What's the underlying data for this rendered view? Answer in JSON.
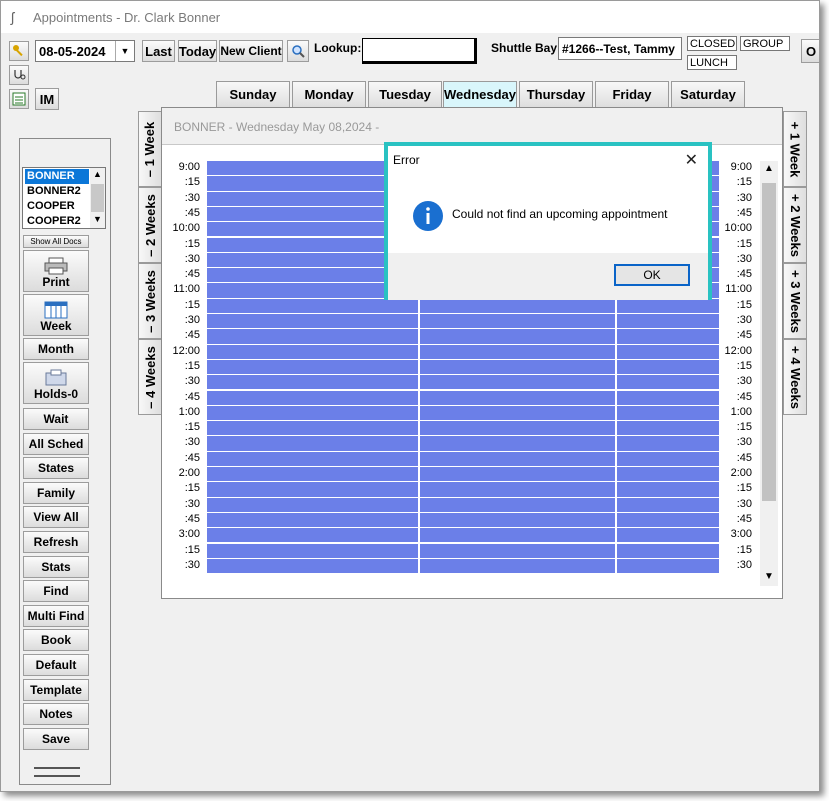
{
  "window": {
    "title": "Appointments - Dr. Clark Bonner"
  },
  "toolbar": {
    "date_value": "08-05-2024",
    "last_label": "Last",
    "today_label": "Today",
    "new_client_label": "New Client",
    "lookup_label": "Lookup:",
    "lookup_value": "",
    "shuttle_label": "Shuttle Bay",
    "shuttle_value": "#1266--Test, Tammy",
    "closed_label": "CLOSED",
    "group_label": "GROUP",
    "lunch_label": "LUNCH",
    "im_label": "IM",
    "cut_label": "O"
  },
  "day_tabs": [
    "Sunday",
    "Monday",
    "Tuesday",
    "Wednesday",
    "Thursday",
    "Friday",
    "Saturday"
  ],
  "active_day": "Wednesday",
  "left_week_tabs": [
    "– 1 Week",
    "– 2 Weeks",
    "– 3 Weeks",
    "– 4 Weeks"
  ],
  "right_week_tabs": [
    "+ 1 Week",
    "+ 2 Weeks",
    "+ 3 Weeks",
    "+ 4 Weeks"
  ],
  "schedule": {
    "header": "BONNER - Wednesday May 08,2024 -",
    "times": [
      "9:00",
      ":15",
      ":30",
      ":45",
      "10:00",
      ":15",
      ":30",
      ":45",
      "11:00",
      ":15",
      ":30",
      ":45",
      "12:00",
      ":15",
      ":30",
      ":45",
      "1:00",
      ":15",
      ":30",
      ":45",
      "2:00",
      ":15",
      ":30",
      ":45",
      "3:00",
      ":15",
      ":30"
    ],
    "slot_color": "#6b7fe8",
    "divider_color": "#ffffff"
  },
  "sidebar": {
    "doctors": [
      "BONNER",
      "BONNER2",
      "COOPER",
      "COOPER2"
    ],
    "selected_doctor": "BONNER",
    "show_all_docs": "Show All Docs",
    "print_label": "Print",
    "week_label": "Week",
    "month_label": "Month",
    "holds_label": "Holds-0",
    "buttons": [
      "Wait",
      "All Sched",
      "States",
      "Family",
      "View All",
      "Refresh",
      "Stats",
      "Find",
      "Multi Find",
      "Book",
      "Default",
      "Template",
      "Notes",
      "Save"
    ]
  },
  "dialog": {
    "title": "Error",
    "message": "Could not find an upcoming appointment",
    "ok_label": "OK",
    "accent": "#29c2c2"
  }
}
